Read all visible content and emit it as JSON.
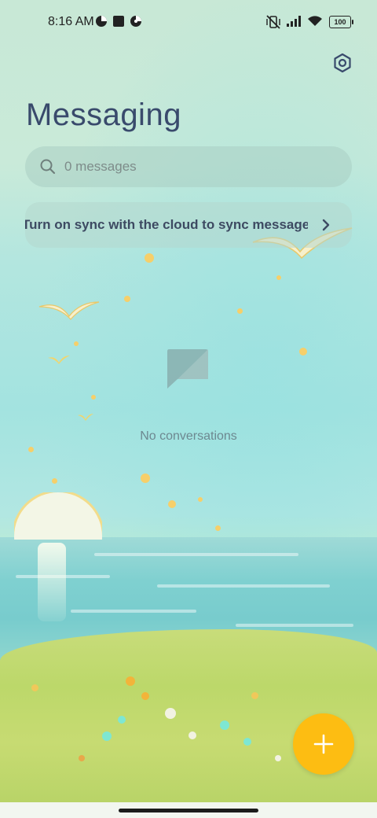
{
  "status_bar": {
    "time": "8:16 AM",
    "battery": "100"
  },
  "header": {
    "title": "Messaging",
    "settings_icon": "settings-hexagon-icon"
  },
  "search": {
    "placeholder": "0 messages",
    "icon": "search-icon"
  },
  "sync_banner": {
    "text": "Turn on sync with the cloud to sync messages",
    "icon": "chevron-right-icon"
  },
  "empty_state": {
    "icon": "message-placeholder-icon",
    "text": "No conversations"
  },
  "fab": {
    "icon": "plus-icon"
  },
  "colors": {
    "accent": "#fdbd12",
    "title": "#394a6c"
  }
}
